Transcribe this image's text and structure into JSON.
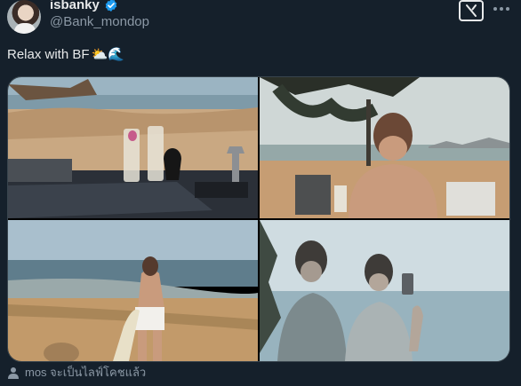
{
  "author": {
    "display_name": "isbanky",
    "handle": "@Bank_mondop",
    "verified": true,
    "verified_color": "#1d9bf0"
  },
  "actions": {
    "grok_icon": "grok-icon",
    "more_icon": "more-horizontal-icon"
  },
  "post": {
    "text": "Relax with BF",
    "emojis": "⛅🌊"
  },
  "media": {
    "count": 4,
    "photos": [
      "beach-table-champagne-photo",
      "shirtless-man-at-beach-table-photo",
      "man-with-surfboard-on-beach-photo",
      "mirror-selfie-reflection-photo"
    ]
  },
  "social_context": {
    "icon": "person-icon",
    "text": "mos จะเป็นไลฟ์โคชแล้ว"
  },
  "colors": {
    "background": "#15202b",
    "text_primary": "#e7e9ea",
    "text_secondary": "#8b98a5",
    "border": "#38444d"
  }
}
